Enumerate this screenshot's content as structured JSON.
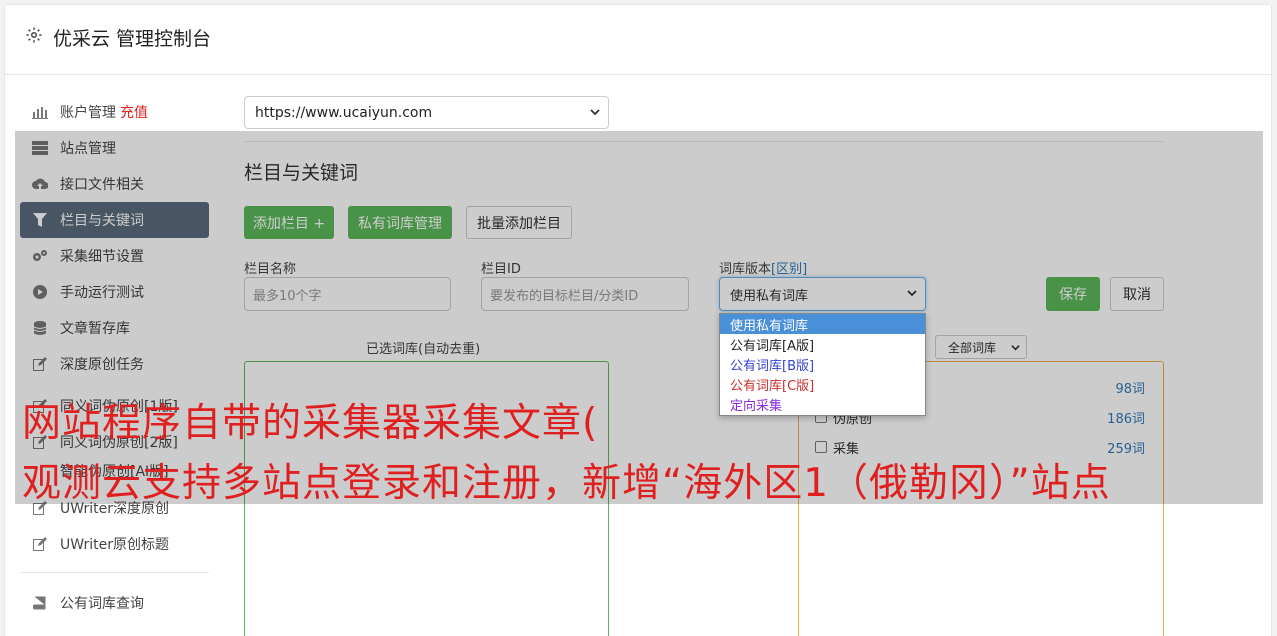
{
  "header": {
    "title": "优采云 管理控制台"
  },
  "sidebar": {
    "items": [
      {
        "label": "账户管理",
        "extra": "充值"
      },
      {
        "label": "站点管理"
      },
      {
        "label": "接口文件相关"
      },
      {
        "label": "栏目与关键词"
      },
      {
        "label": "采集细节设置"
      },
      {
        "label": "手动运行测试"
      },
      {
        "label": "文章暂存库"
      },
      {
        "label": "深度原创任务"
      },
      {
        "label": "同义词伪原创[1版]"
      },
      {
        "label": "同义词伪原创[2版]"
      },
      {
        "label": "智能伪原创[AI版]"
      },
      {
        "label": "UWriter深度原创"
      },
      {
        "label": "UWriter原创标题"
      },
      {
        "label": "公有词库查询"
      }
    ]
  },
  "main": {
    "site_select": "https://www.ucaiyun.com",
    "section_title": "栏目与关键词",
    "buttons": {
      "add": "添加栏目 +",
      "private": "私有词库管理",
      "batch": "批量添加栏目",
      "save": "保存",
      "cancel": "取消"
    },
    "form": {
      "name_label": "栏目名称",
      "name_placeholder": "最多10个字",
      "id_label": "栏目ID",
      "id_placeholder": "要发布的目标栏目/分类ID",
      "version_label": "词库版本",
      "version_link": "[区别]",
      "version_value": "使用私有词库"
    },
    "dropdown": [
      "使用私有词库",
      "公有词库[A版]",
      "公有词库[B版]",
      "公有词库[C版]",
      "定向采集"
    ],
    "left_panel_title": "已选词库(自动去重)",
    "right_filter": "全部词库",
    "right_rows": [
      {
        "label": "",
        "count": "98词"
      },
      {
        "label": "伪原创",
        "count": "186词"
      },
      {
        "label": "采集",
        "count": "259词"
      }
    ]
  },
  "caption": {
    "line1": "网站程序自带的采集器采集文章(",
    "line2": "观测云支持多站点登录和注册，新增“海外区1（俄勒冈）”站点"
  },
  "colors": {
    "green": "#5cb85c",
    "orange": "#f0ad4e",
    "red": "#e02020",
    "active": "#5b6b7c",
    "blue": "#337ab7",
    "purple": "#8a2be2",
    "crimson": "#c9302c"
  }
}
